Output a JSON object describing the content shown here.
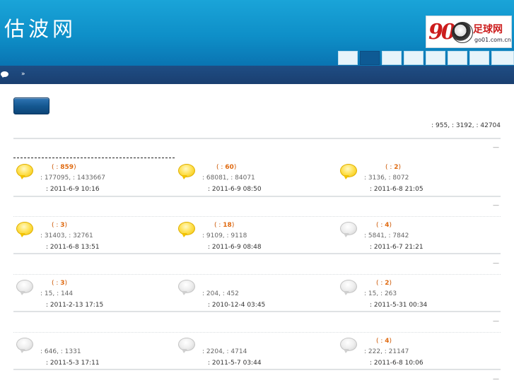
{
  "header": {
    "site_title": "估波网",
    "partner_logo": {
      "number": "90",
      "name": "足球网",
      "url": "go01.com.cn"
    },
    "nav_tabs_count": 8
  },
  "stats_line": ": 955, : 3192, : 42704",
  "breadcrumb_separator": "»",
  "section_marker": "—",
  "forums": [
    {
      "count_prefix": "( :",
      "count": "859",
      "count_suffix": ")",
      "stats": ": 177095, : 1433667",
      "time": ": 2011-6-9 10:16",
      "icon": "yellow"
    },
    {
      "count_prefix": "( :",
      "count": "60",
      "count_suffix": ")",
      "stats": ": 68081, : 84071",
      "time": ": 2011-6-9 08:50",
      "icon": "yellow"
    },
    {
      "count_prefix": "( :",
      "count": "2",
      "count_suffix": ")",
      "stats": ": 3136, : 8072",
      "time": ": 2011-6-8 21:05",
      "icon": "yellow"
    },
    {
      "count_prefix": "( :",
      "count": "3",
      "count_suffix": ")",
      "stats": ": 31403, : 32761",
      "time": ": 2011-6-8 13:51",
      "icon": "yellow"
    },
    {
      "count_prefix": "( :",
      "count": "18",
      "count_suffix": ")",
      "stats": ": 9109, : 9118",
      "time": ": 2011-6-9 08:48",
      "icon": "yellow"
    },
    {
      "count_prefix": "( :",
      "count": "4",
      "count_suffix": ")",
      "stats": ": 5841, : 7842",
      "time": ": 2011-6-7 21:21",
      "icon": "gray"
    },
    {
      "count_prefix": "( :",
      "count": "3",
      "count_suffix": ")",
      "stats": ": 15, : 144",
      "time": ": 2011-2-13 17:15",
      "icon": "gray"
    },
    {
      "count_prefix": "",
      "count": "",
      "count_suffix": "",
      "stats": ": 204, : 452",
      "time": ": 2010-12-4 03:45",
      "icon": "gray"
    },
    {
      "count_prefix": "( :",
      "count": "2",
      "count_suffix": ")",
      "stats": ": 15, : 263",
      "time": ": 2011-5-31 00:34",
      "icon": "gray"
    },
    {
      "count_prefix": "",
      "count": "",
      "count_suffix": "",
      "stats": ": 646, : 1331",
      "time": ": 2011-5-3 17:11",
      "icon": "gray"
    },
    {
      "count_prefix": "",
      "count": "",
      "count_suffix": "",
      "stats": ": 2204, : 4714",
      "time": ": 2011-5-7 03:44",
      "icon": "gray"
    },
    {
      "count_prefix": "( :",
      "count": "4",
      "count_suffix": ")",
      "stats": ": 222, : 21147",
      "time": ": 2011-6-8 10:06",
      "icon": "gray"
    }
  ]
}
